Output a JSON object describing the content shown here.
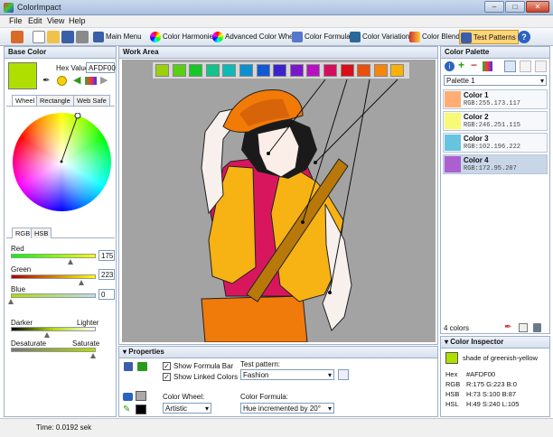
{
  "window": {
    "title": "ColorImpact",
    "min": "–",
    "max": "□",
    "close": "✕"
  },
  "menu": [
    "File",
    "Edit",
    "View",
    "Help"
  ],
  "toolbar": {
    "main_menu": "Main Menu",
    "color_harmonies": "Color Harmonies",
    "advanced_wheel": "Advanced Color Wheel",
    "color_formulae": "Color Formulae",
    "color_variations": "Color Variations",
    "color_blender": "Color Blender",
    "test_patterns": "Test Patterns"
  },
  "base_color": {
    "title": "Base Color",
    "hex_label": "Hex Value:",
    "hex_value": "AFDF00",
    "swatch_color": "#AFDF00",
    "tabs": [
      "Wheel",
      "Rectangle",
      "Web Safe"
    ],
    "model_tabs": [
      "RGB",
      "HSB"
    ],
    "red_label": "Red",
    "red_value": "175",
    "green_label": "Green",
    "green_value": "223",
    "blue_label": "Blue",
    "blue_value": "0",
    "darker": "Darker",
    "lighter": "Lighter",
    "desaturate": "Desaturate",
    "saturate": "Saturate"
  },
  "work_area": {
    "title": "Work Area",
    "strip_colors": [
      "#9ad10c",
      "#58cf14",
      "#16c826",
      "#10c48a",
      "#0cbab8",
      "#0e8fd0",
      "#1257d4",
      "#3a22cc",
      "#7a16cc",
      "#b910c4",
      "#d40e5c",
      "#d80e18",
      "#e8500c",
      "#f5860a",
      "#f9b10a"
    ]
  },
  "properties": {
    "title": "Properties",
    "show_formula_bar": "Show Formula Bar",
    "show_linked_colors": "Show Linked Colors",
    "test_pattern_label": "Test pattern:",
    "test_pattern_value": "Fashion",
    "color_wheel_label": "Color Wheel:",
    "color_wheel_value": "Artistic",
    "color_formula_label": "Color Formula:",
    "color_formula_value": "Hue incremented by 20°"
  },
  "palette": {
    "title": "Color Palette",
    "selected": "Palette 1",
    "items": [
      {
        "name": "Color 1",
        "rgb": "RGB:255.173.117",
        "color": "#FFAD75"
      },
      {
        "name": "Color 2",
        "rgb": "RGB:246.251.115",
        "color": "#F6FB73"
      },
      {
        "name": "Color 3",
        "rgb": "RGB:102.196.222",
        "color": "#66C4DE"
      },
      {
        "name": "Color 4",
        "rgb": "RGB:172.95.207",
        "color": "#AC5FCF"
      }
    ],
    "count": "4 colors"
  },
  "inspector": {
    "title": "Color Inspector",
    "description": "shade of greenish-yellow",
    "hex_label": "Hex",
    "hex": "#AFDF00",
    "rgb_label": "RGB",
    "rgb": "R:175  G:223  B:0",
    "hsb_label": "HSB",
    "hsb": "H:73  S:100  B:87",
    "hsl_label": "HSL",
    "hsl": "H:49  S:240  L:105"
  },
  "status": {
    "time": "Time: 0.0192 sek"
  }
}
